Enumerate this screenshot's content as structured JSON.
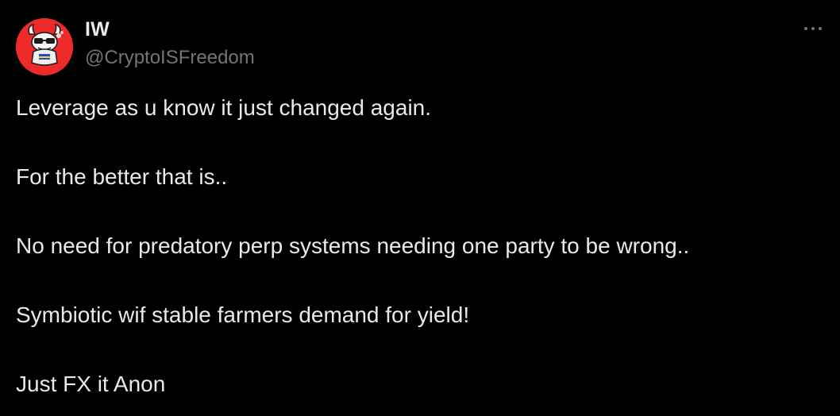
{
  "tweet": {
    "author": {
      "display_name": "IW",
      "handle": "@CryptoISFreedom",
      "avatar_icon": "devil-mascot-avatar-icon",
      "avatar_color": "#ef2a2a"
    },
    "more_icon": "more-horizontal-icon",
    "lines": [
      "Leverage as u know it just changed again.",
      "For the better that is..",
      "No need for predatory perp systems needing one party to be wrong..",
      "Symbiotic wif stable farmers demand for yield!",
      "Just FX it Anon"
    ]
  },
  "colors": {
    "background": "#000000",
    "text_primary": "#e7e9ea",
    "text_secondary": "#71767b"
  }
}
